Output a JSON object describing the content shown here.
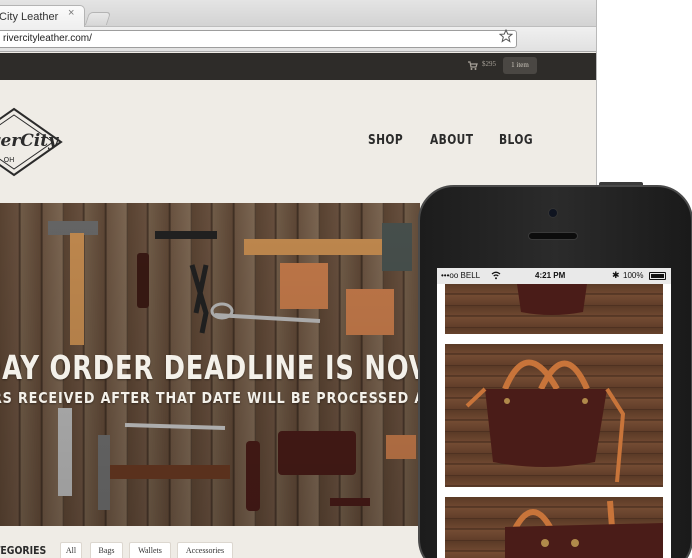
{
  "browser": {
    "tab_title": "City Leather",
    "tab_close": "×",
    "url": "rivercityleather.com/",
    "bookmark_icon": "star-icon"
  },
  "store": {
    "cart_total": "$295",
    "cart_count": "1 item",
    "cart_icon": "cart-icon"
  },
  "header": {
    "logo_text": "RiverCity",
    "logo_sub": "OH",
    "nav": [
      "SHOP",
      "ABOUT",
      "BLOG"
    ]
  },
  "hero": {
    "headline": "DAY ORDER DEADLINE IS NOVEM",
    "subline": "RS RECEIVED AFTER THAT DATE WILL BE PROCESSED AFTER"
  },
  "categories": {
    "label": "TEGORIES",
    "items": [
      "All",
      "Bags",
      "Wallets",
      "Accessories"
    ]
  },
  "phone": {
    "carrier": "•••oo BELL",
    "time": "4:21 PM",
    "battery": "100%",
    "bluetooth": "✱"
  },
  "colors": {
    "site_bg": "#efece6",
    "strip_bg": "#2e2c29",
    "wood": "#6b5240",
    "leather_brown": "#4a1c18",
    "tan_strap": "#c8743a"
  }
}
